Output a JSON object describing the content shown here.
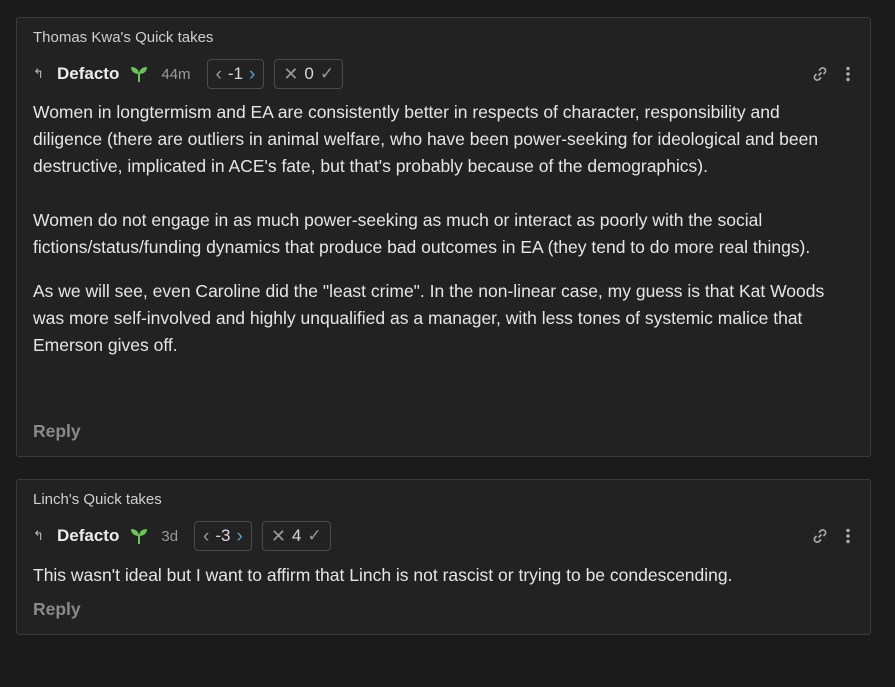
{
  "comments": [
    {
      "post_title": "Thomas Kwa's Quick takes",
      "author": "Defacto",
      "time": "44m",
      "karma": "-1",
      "agreement": "0",
      "paragraphs": [
        "Women in longtermism and EA are consistently better in respects of character, responsibility and diligence (there are outliers in animal welfare, who have been power-seeking for ideological and been destructive, implicated in ACE's fate, but that's probably because of the demographics).",
        "Women do not engage in as much power-seeking as much or interact as poorly with the social fictions/status/funding dynamics that produce bad outcomes in EA (they tend to do more real things).",
        "As we will see, even Caroline did the \"least crime\". In the non-linear case, my guess is that Kat Woods was more self-involved and highly unqualified as a manager, with less tones of systemic malice that Emerson gives off."
      ],
      "reply_label": "Reply"
    },
    {
      "post_title": "Linch's Quick takes",
      "author": "Defacto",
      "time": "3d",
      "karma": "-3",
      "agreement": "4",
      "paragraphs": [
        "This wasn't ideal but I want to affirm that Linch is not rascist or trying to be condescending."
      ],
      "reply_label": "Reply"
    }
  ],
  "icons": {
    "parent": "parent-comment-icon",
    "sprout": "new-user-sprout-icon",
    "link": "link-icon",
    "menu": "more-options-icon"
  },
  "colors": {
    "background": "#1b1b1b",
    "card": "#222222",
    "sprout": "#6cc35a",
    "upvote": "#5aa0c9"
  }
}
